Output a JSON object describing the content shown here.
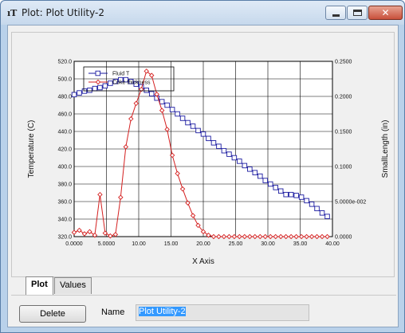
{
  "window": {
    "title": "Plot: Plot Utility-2",
    "app_icon_text": "ıT",
    "minimize_icon": "minimize-icon",
    "maximize_icon": "maximize-icon",
    "close_icon": "close-icon",
    "close_glyph": "✕"
  },
  "tabs": [
    {
      "label": "Plot",
      "active": true
    },
    {
      "label": "Values",
      "active": false
    }
  ],
  "controls": {
    "delete_label": "Delete",
    "name_label": "Name",
    "name_value": "Plot Utility-2"
  },
  "colors": {
    "fluid_t": "#1a1aa0",
    "coke_thickness": "#d42020"
  },
  "chart_data": {
    "type": "line",
    "xlabel": "X Axis",
    "ylabel": "Temperature (C)",
    "y2label": "SmallLength (in)",
    "xlim": [
      0,
      40
    ],
    "ylim": [
      320,
      520
    ],
    "y2lim": [
      0,
      0.25
    ],
    "grid": true,
    "legend_placement": "top-left",
    "x_ticks": [
      "0.0000",
      "5.0000",
      "10.00",
      "15.00",
      "20.00",
      "25.00",
      "30.00",
      "35.00",
      "40.00"
    ],
    "y_ticks": [
      "320.0",
      "340.0",
      "360.0",
      "380.0",
      "400.0",
      "420.0",
      "440.0",
      "460.0",
      "480.0",
      "500.0",
      "520.0"
    ],
    "y2_ticks": [
      "0.0000",
      "5.0000e-002",
      "0.1000",
      "0.1500",
      "0.2000",
      "0.2500"
    ],
    "series": [
      {
        "name": "Fluid T",
        "axis": "left",
        "marker": "square",
        "x": [
          0.0,
          0.8,
          1.6,
          2.4,
          3.2,
          4.0,
          4.8,
          5.6,
          6.4,
          7.2,
          8.0,
          8.8,
          9.6,
          10.4,
          11.2,
          12.0,
          12.8,
          13.6,
          14.4,
          15.2,
          16.0,
          16.8,
          17.6,
          18.4,
          19.2,
          20.0,
          20.8,
          21.6,
          22.4,
          23.2,
          24.0,
          24.8,
          25.6,
          26.4,
          27.2,
          28.0,
          28.8,
          29.6,
          30.4,
          31.2,
          32.0,
          32.8,
          33.6,
          34.4,
          35.2,
          36.0,
          36.8,
          37.6,
          38.4,
          39.2
        ],
        "values": [
          482,
          484,
          486,
          487,
          489,
          490,
          492,
          495,
          497,
          499,
          499,
          497,
          494,
          491,
          487,
          483,
          478,
          474,
          470,
          465,
          460,
          455,
          450,
          446,
          441,
          437,
          432,
          427,
          423,
          418,
          414,
          410,
          406,
          401,
          397,
          393,
          389,
          384,
          380,
          376,
          372,
          368,
          368,
          367,
          365,
          361,
          357,
          352,
          347,
          343
        ]
      },
      {
        "name": "Coke thickness",
        "axis": "right",
        "marker": "diamond",
        "x": [
          0.0,
          0.8,
          1.6,
          2.4,
          3.2,
          4.0,
          4.8,
          5.6,
          6.4,
          7.2,
          8.0,
          8.8,
          9.6,
          10.4,
          11.2,
          12.0,
          12.8,
          13.6,
          14.4,
          15.2,
          16.0,
          16.8,
          17.6,
          18.4,
          19.2,
          20.0,
          20.8,
          21.6,
          22.4,
          23.2,
          24.0,
          24.8,
          25.6,
          26.4,
          27.2,
          28.0,
          28.8,
          29.6,
          30.4,
          31.2,
          32.0,
          32.8,
          33.6,
          34.4,
          35.2,
          36.0,
          36.8,
          37.6,
          38.4,
          39.2
        ],
        "values": [
          0.006,
          0.009,
          0.004,
          0.007,
          0.002,
          0.06,
          0.005,
          0.001,
          0.003,
          0.056,
          0.128,
          0.168,
          0.19,
          0.21,
          0.236,
          0.23,
          0.203,
          0.18,
          0.153,
          0.116,
          0.09,
          0.068,
          0.048,
          0.03,
          0.016,
          0.007,
          0.002,
          0.0,
          0.0,
          0.0,
          0.0,
          0.0,
          0.0,
          0.0,
          0.0,
          0.0,
          0.0,
          0.0,
          0.0,
          0.0,
          0.0,
          0.0,
          0.0,
          0.0,
          0.0,
          0.0,
          0.0,
          0.0,
          0.0,
          0.0
        ]
      }
    ]
  }
}
